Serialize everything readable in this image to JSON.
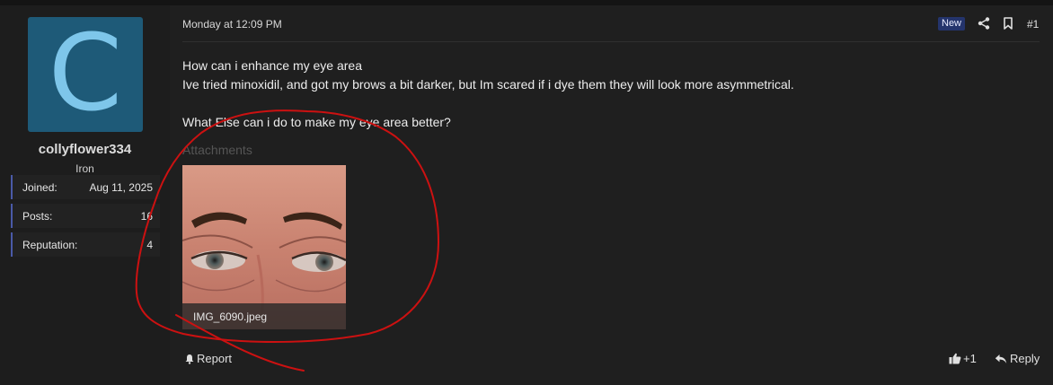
{
  "post": {
    "datetime": "Monday at 12:09 PM",
    "badge": "New",
    "number": "#1",
    "lines": [
      "How can i enhance my eye area",
      "Ive tried minoxidil, and got my brows a bit darker, but Im scared if i dye them they will look more asymmetrical.",
      "",
      "What Else can i do to make my eye area better?"
    ],
    "attachments_label": "Attachments",
    "attachment": {
      "filename": "IMG_6090.jpeg"
    },
    "actions": {
      "report": "Report",
      "like": "+1",
      "reply": "Reply"
    }
  },
  "user": {
    "avatar_letter": "C",
    "avatar_color": "#1e5a78",
    "name": "collyflower334",
    "title": "Iron",
    "stats": [
      {
        "label": "Joined:",
        "value": "Aug 11, 2025"
      },
      {
        "label": "Posts:",
        "value": "16"
      },
      {
        "label": "Reputation:",
        "value": "4"
      }
    ]
  },
  "colors": {
    "annotation": "#cc1111",
    "badge": "#24346c",
    "stat_accent": "#4a5aa8"
  },
  "icons": [
    "share-icon",
    "bookmark-icon",
    "bell-icon",
    "thumbs-up-icon",
    "reply-icon"
  ]
}
